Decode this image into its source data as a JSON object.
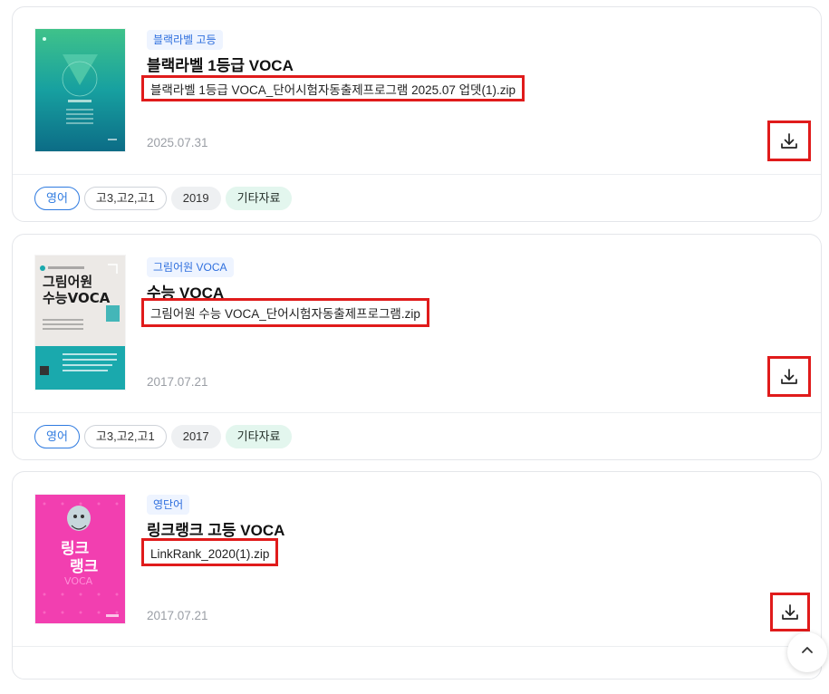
{
  "colors": {
    "highlight_red": "#e01b1b",
    "badge_blue": "#2f6fde",
    "subject_tag_blue": "#2f7be0",
    "type_tag_green_bg": "#e3f6ee"
  },
  "items": [
    {
      "series": "블랙라벨 고등",
      "title": "블랙라벨 1등급 VOCA",
      "file_name": "블랙라벨 1등급 VOCA_단어시험자동출제프로그램 2025.07 업뎃(1).zip",
      "date": "2025.07.31",
      "cover_icon": "book-cover-blacklabel-voca",
      "download_icon": "download-icon",
      "tags": {
        "subject": "영어",
        "grade": "고3,고2,고1",
        "year": "2019",
        "type": "기타자료"
      }
    },
    {
      "series": "그림어원 VOCA",
      "title": "수능 VOCA",
      "file_name": "그림어원 수능 VOCA_단어시험자동출제프로그램.zip",
      "date": "2017.07.21",
      "cover_icon": "book-cover-geurimeowon-voca",
      "cover_text": "그림어원\n수능VOCA",
      "download_icon": "download-icon",
      "tags": {
        "subject": "영어",
        "grade": "고3,고2,고1",
        "year": "2017",
        "type": "기타자료"
      }
    },
    {
      "series": "영단어",
      "title": "링크랭크 고등 VOCA",
      "file_name": "LinkRank_2020(1).zip",
      "date": "2017.07.21",
      "cover_icon": "book-cover-linkrank-voca",
      "cover_text": "링크\n랭크",
      "download_icon": "download-icon"
    }
  ],
  "scroll_top_icon": "chevron-up-icon"
}
